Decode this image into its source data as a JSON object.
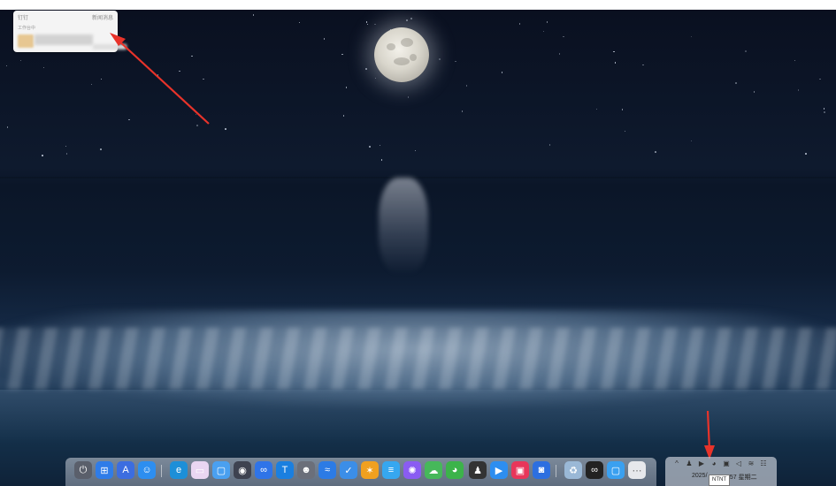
{
  "widget": {
    "title": "钉钉",
    "link_label": "新闻消息",
    "subtitle": "工作台中"
  },
  "taskbar": {
    "apps": [
      {
        "name": "power-icon",
        "glyph": "⏻",
        "color": "#5a5f6b"
      },
      {
        "name": "windows-start-icon",
        "glyph": "⊞",
        "color": "#2f7ce8"
      },
      {
        "name": "app-store-icon",
        "glyph": "A",
        "color": "#3c6de0"
      },
      {
        "name": "finder-icon",
        "glyph": "☺",
        "color": "#2d8ef0"
      },
      {
        "name": "edge-browser-icon",
        "glyph": "e",
        "color": "#1d8fd8"
      },
      {
        "name": "folder-icon",
        "glyph": "▭",
        "color": "#e9d6f2"
      },
      {
        "name": "notes-icon",
        "glyph": "▢",
        "color": "#4aa0f0"
      },
      {
        "name": "steering-icon",
        "glyph": "◉",
        "color": "#3e4250"
      },
      {
        "name": "baidu-netdisk-icon",
        "glyph": "∞",
        "color": "#2f74e8"
      },
      {
        "name": "translate-icon",
        "glyph": "T",
        "color": "#1a7fe0"
      },
      {
        "name": "avatar-app-icon",
        "glyph": "☻",
        "color": "#6b6f7a"
      },
      {
        "name": "feishu-icon",
        "glyph": "≈",
        "color": "#2c7be5"
      },
      {
        "name": "check-app-icon",
        "glyph": "✓",
        "color": "#3b8ee8"
      },
      {
        "name": "butterfly-icon",
        "glyph": "✶",
        "color": "#f0a020"
      },
      {
        "name": "document-icon",
        "glyph": "≡",
        "color": "#36a7f0"
      },
      {
        "name": "puzzle-icon",
        "glyph": "✺",
        "color": "#8a5cf2"
      },
      {
        "name": "cloud-icon",
        "glyph": "☁",
        "color": "#46b85a"
      },
      {
        "name": "wechat-icon",
        "glyph": "◕",
        "color": "#3cb34a"
      },
      {
        "name": "qq-icon",
        "glyph": "♟",
        "color": "#333333"
      },
      {
        "name": "arrow-app-icon",
        "glyph": "▶",
        "color": "#2d8ef0"
      },
      {
        "name": "image-editor-icon",
        "glyph": "▣",
        "color": "#e8365a"
      },
      {
        "name": "screen-recorder-icon",
        "glyph": "◙",
        "color": "#2d6fe0"
      },
      {
        "name": "recycle-bin-icon",
        "glyph": "♻",
        "color": "#9ab8d6"
      },
      {
        "name": "mask-app-icon",
        "glyph": "∞",
        "color": "#222222"
      },
      {
        "name": "chat-app-icon",
        "glyph": "▢",
        "color": "#3aa0f0"
      },
      {
        "name": "more-apps-icon",
        "glyph": "⋯",
        "color": "#e6e8ec"
      }
    ]
  },
  "tray": {
    "icons": [
      {
        "name": "chevron-up-icon",
        "glyph": "^"
      },
      {
        "name": "qq-tray-icon",
        "glyph": "♟"
      },
      {
        "name": "arrow-tray-icon",
        "glyph": "▶"
      },
      {
        "name": "wechat-tray-icon",
        "glyph": "◕"
      },
      {
        "name": "nvidia-tray-icon",
        "glyph": "▣"
      },
      {
        "name": "volume-icon",
        "glyph": "◁"
      },
      {
        "name": "wifi-icon",
        "glyph": "≋"
      },
      {
        "name": "network-icon",
        "glyph": "☷"
      }
    ],
    "date_text": "2025/",
    "time_text": "8:57 星期二"
  },
  "tooltip": {
    "text": "NTNT"
  }
}
